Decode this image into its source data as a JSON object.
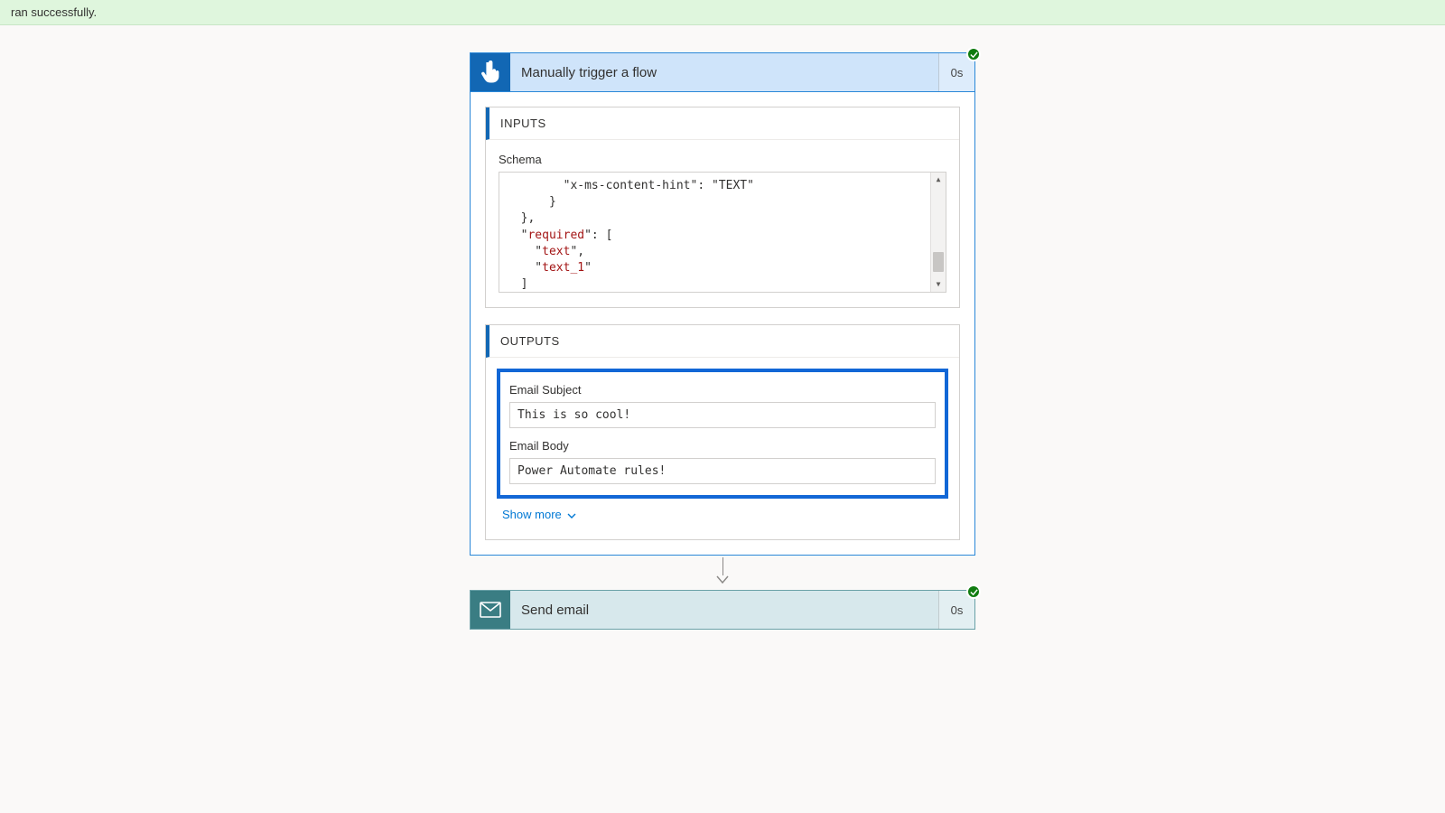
{
  "banner": {
    "text": "ran successfully."
  },
  "trigger": {
    "title": "Manually trigger a flow",
    "duration": "0s",
    "inputs": {
      "header": "INPUTS",
      "schema_label": "Schema",
      "schema_lines": {
        "l1": "        \"x-ms-content-hint\": \"TEXT\"",
        "l2": "      }",
        "l3": "  },",
        "l4_a": "  \"",
        "l4_key": "required",
        "l4_b": "\": [",
        "l5_a": "    \"",
        "l5_v": "text",
        "l5_b": "\",",
        "l6_a": "    \"",
        "l6_v": "text_1",
        "l6_b": "\"",
        "l7": "  ]",
        "l8": "}"
      }
    },
    "outputs": {
      "header": "OUTPUTS",
      "fields": [
        {
          "label": "Email Subject",
          "value": "This is so cool!"
        },
        {
          "label": "Email Body",
          "value": "Power Automate rules!"
        }
      ],
      "show_more": "Show more"
    }
  },
  "action": {
    "title": "Send email",
    "duration": "0s"
  }
}
